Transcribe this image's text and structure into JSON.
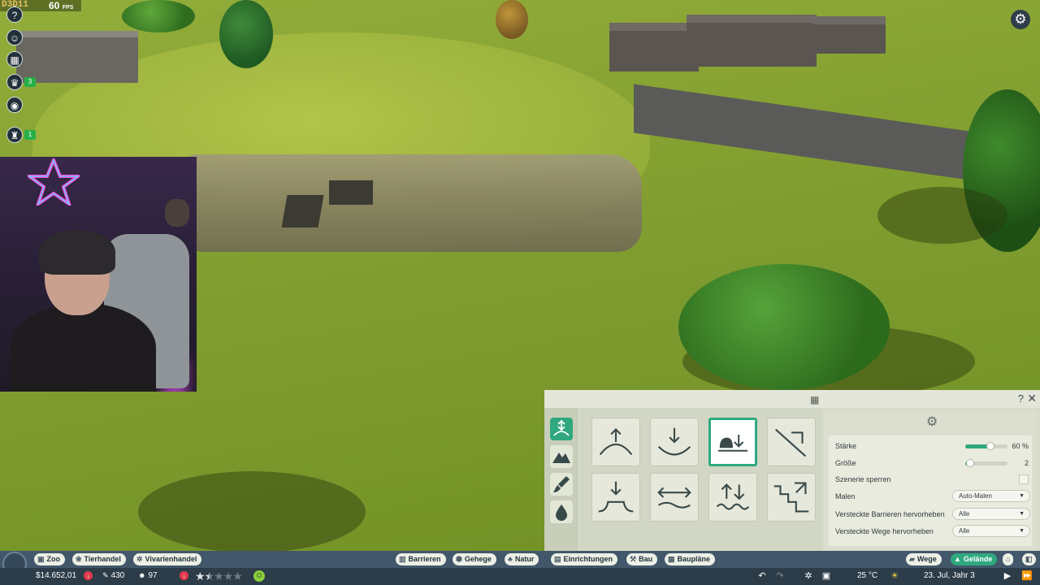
{
  "hud": {
    "debug_code": "D3D11",
    "fps_value": "60",
    "fps_unit": "FPS"
  },
  "left_sidebar": {
    "items": [
      {
        "icon": "help-icon",
        "glyph": "?"
      },
      {
        "icon": "guests-icon",
        "glyph": "☺"
      },
      {
        "icon": "calendar-icon",
        "glyph": "▦"
      },
      {
        "icon": "trophy-icon",
        "glyph": "♛",
        "badge": "3"
      },
      {
        "icon": "view-icon",
        "glyph": "◉"
      },
      {
        "icon": "chess-piece-icon",
        "glyph": "♜",
        "badge": "1"
      }
    ]
  },
  "terrain_panel": {
    "rail": [
      {
        "icon": "terrain-height-icon",
        "active": true
      },
      {
        "icon": "mountain-icon",
        "active": false
      },
      {
        "icon": "paint-brush-icon",
        "active": false
      },
      {
        "icon": "water-drop-icon",
        "active": false
      }
    ],
    "tools": [
      {
        "icon": "raise-terrain-icon",
        "selected": false
      },
      {
        "icon": "lower-terrain-icon",
        "selected": false
      },
      {
        "icon": "flatten-terrain-icon",
        "selected": true
      },
      {
        "icon": "smooth-slope-icon",
        "selected": false
      },
      {
        "icon": "plateau-terrain-icon",
        "selected": false
      },
      {
        "icon": "level-terrain-icon",
        "selected": false
      },
      {
        "icon": "roughen-terrain-icon",
        "selected": false
      },
      {
        "icon": "cliff-step-icon",
        "selected": false
      }
    ],
    "settings": {
      "strength_label": "Stärke",
      "strength_value": "60 %",
      "strength_fraction": 0.6,
      "size_label": "Größe",
      "size_value": "2",
      "size_fraction": 0.12,
      "lock_scenery_label": "Szenerie sperren",
      "paint_label": "Malen",
      "paint_value": "Auto-Malen",
      "hidden_barriers_label": "Versteckte Barrieren hervorheben",
      "hidden_barriers_value": "Alle",
      "hidden_paths_label": "Versteckte Wege hervorheben",
      "hidden_paths_value": "Alle"
    }
  },
  "bottom_bar": {
    "left": {
      "zoo": "Zoo",
      "animal_trade": "Tierhandel",
      "vivarium_trade": "Vivarienhandel"
    },
    "center": {
      "barriers": "Barrieren",
      "enclosures": "Gehege",
      "nature": "Natur",
      "facilities": "Einrichtungen",
      "build": "Bau",
      "blueprints": "Baupläne"
    },
    "right": {
      "paths": "Wege",
      "terrain": "Gelände"
    },
    "stats": {
      "money": "$14.652,01",
      "conservation": "430",
      "guests": "97",
      "rating_stars": 1.5
    },
    "status": {
      "temperature": "25 °C",
      "date": "23. Jul, Jahr 3"
    }
  },
  "colors": {
    "accent": "#2fa87e",
    "bar_top": "#42576a",
    "bar_bottom": "#2c3c48",
    "panel_bg": "#d7dbc9",
    "alert": "#e23a4a"
  }
}
